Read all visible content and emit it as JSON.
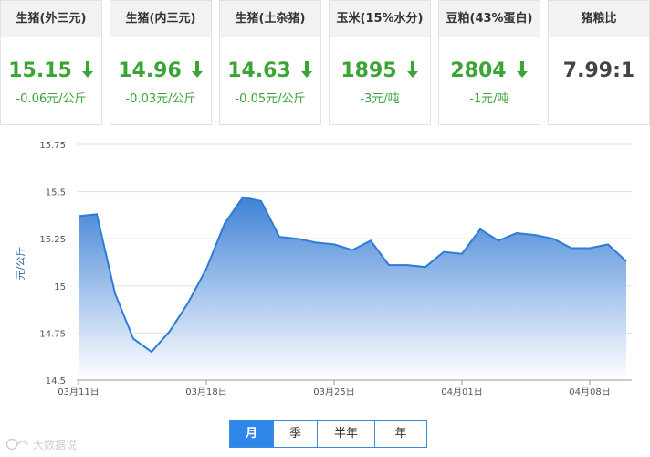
{
  "cards": [
    {
      "title": "生猪(外三元)",
      "price": "15.15",
      "change": "-0.06元/公斤",
      "trend": "down"
    },
    {
      "title": "生猪(内三元)",
      "price": "14.96",
      "change": "-0.03元/公斤",
      "trend": "down"
    },
    {
      "title": "生猪(土杂猪)",
      "price": "14.63",
      "change": "-0.05元/公斤",
      "trend": "down"
    },
    {
      "title": "玉米(15%水分)",
      "price": "1895",
      "change": "-3元/吨",
      "trend": "down"
    },
    {
      "title": "豆粕(43%蛋白)",
      "price": "2804",
      "change": "-1元/吨",
      "trend": "down"
    }
  ],
  "ratio_card": {
    "title": "猪粮比",
    "value": "7.99:1"
  },
  "colors": {
    "down": "#3aa535",
    "accent": "#2e87e8",
    "area_top": "#3f82d6",
    "line": "#2f7bd6"
  },
  "chart_data": {
    "type": "area",
    "ylabel": "元/公斤",
    "ylim": [
      14.5,
      15.75
    ],
    "yticks": [
      "14.5",
      "14.75",
      "15",
      "15.25",
      "15.5",
      "15.75"
    ],
    "xticks": [
      {
        "label": "03月11日",
        "day": 0
      },
      {
        "label": "03月18日",
        "day": 7
      },
      {
        "label": "03月25日",
        "day": 14
      },
      {
        "label": "04月01日",
        "day": 21
      },
      {
        "label": "04月08日",
        "day": 28
      }
    ],
    "series": [
      {
        "values": [
          15.37,
          15.38,
          14.96,
          14.72,
          14.65,
          14.76,
          14.91,
          15.09,
          15.33,
          15.47,
          15.45,
          15.26,
          15.25,
          15.23,
          15.22,
          15.19,
          15.24,
          15.11,
          15.11,
          15.1,
          15.18,
          15.17,
          15.3,
          15.24,
          15.28,
          15.27,
          15.25,
          15.2,
          15.2,
          15.22,
          15.13
        ]
      }
    ],
    "grid": true
  },
  "range_tabs": [
    "月",
    "季",
    "半年",
    "年"
  ],
  "active_tab": "月",
  "watermark": "大数据说"
}
